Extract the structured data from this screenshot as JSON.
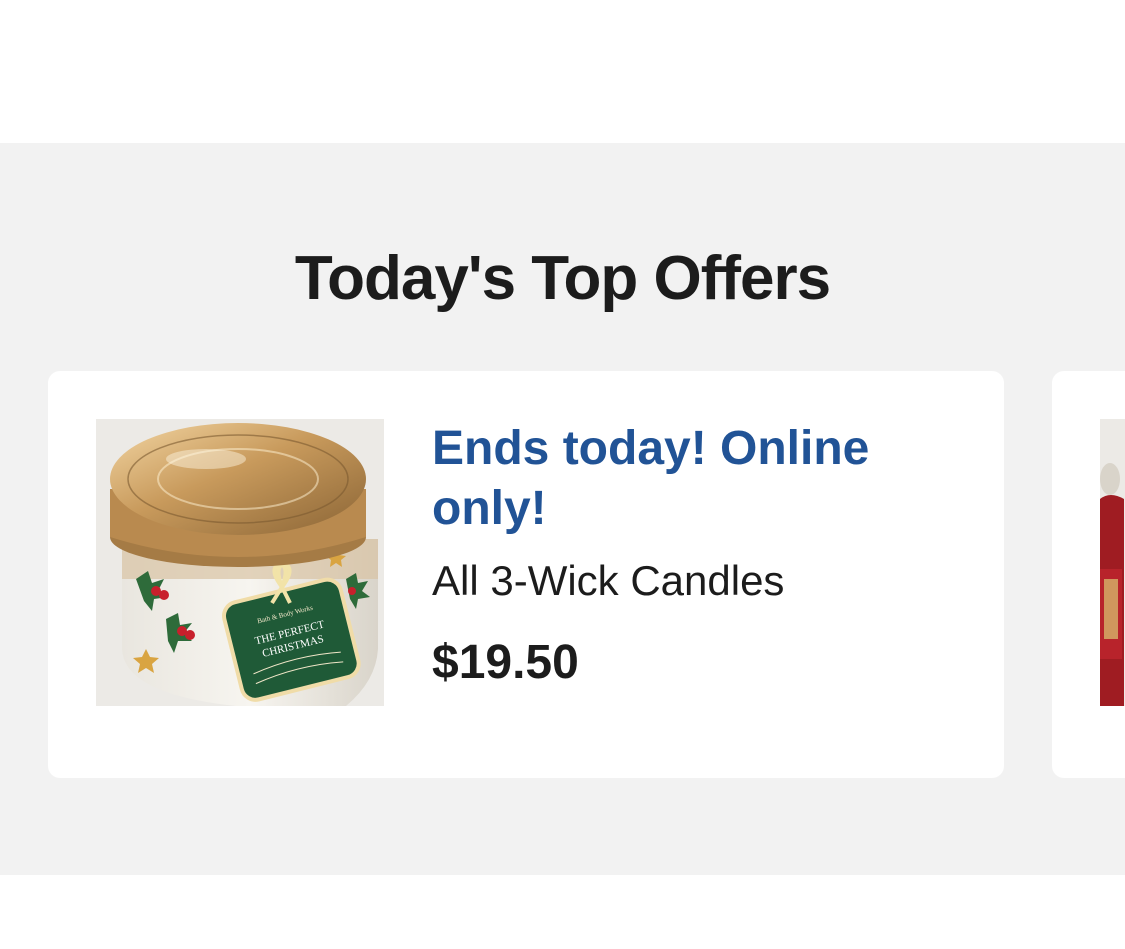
{
  "section": {
    "title": "Today's Top Offers"
  },
  "offers": [
    {
      "headline": "Ends today! Online only!",
      "description": "All 3-Wick Candles",
      "price": "$19.50",
      "image": {
        "label_brand": "Bath & Body Works",
        "label_title": "THE PERFECT CHRISTMAS"
      }
    }
  ],
  "colors": {
    "headline_blue": "#215396",
    "section_bg": "#f2f2f2",
    "card_bg": "#ffffff",
    "text_dark": "#1c1c1c"
  }
}
